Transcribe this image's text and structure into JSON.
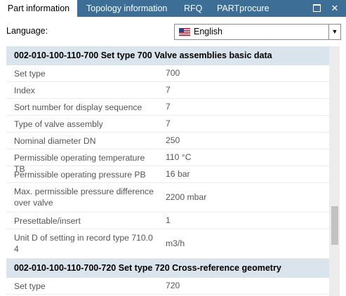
{
  "tabs": [
    {
      "label": "Part information"
    },
    {
      "label": "Topology information"
    },
    {
      "label": "RFQ"
    },
    {
      "label": "PARTprocure"
    }
  ],
  "window": {
    "close_symbol": "✕"
  },
  "language": {
    "label": "Language:",
    "selected": "English",
    "flag_icon": "us-flag-icon"
  },
  "sections": [
    {
      "title": "002-010-100-110-700 Set type 700 Valve assemblies basic data",
      "rows": [
        {
          "key": "Set type",
          "value": "700"
        },
        {
          "key": "Index",
          "value": "7"
        },
        {
          "key": "Sort number for display sequence",
          "value": "7"
        },
        {
          "key": "Type of valve assembly",
          "value": "7"
        },
        {
          "key": "Nominal diameter DN",
          "value": "250"
        },
        {
          "key": "Permissible operating temperature TB",
          "value": "110 °C"
        },
        {
          "key": "Permissible operating pressure PB",
          "value": "16 bar"
        },
        {
          "key": "Max. permissible pressure difference over valve",
          "value": "2200 mbar"
        },
        {
          "key": "Presettable/insert",
          "value": "1"
        },
        {
          "key": "Unit D of setting in record type 710.0 4",
          "value": "m3/h"
        }
      ]
    },
    {
      "title": "002-010-100-110-700-720 Set type 720 Cross-reference geometry",
      "rows": [
        {
          "key": "Set type",
          "value": "720"
        }
      ]
    }
  ],
  "colors": {
    "tabbar": "#3c6e96",
    "section_header": "#d9e4ec"
  }
}
